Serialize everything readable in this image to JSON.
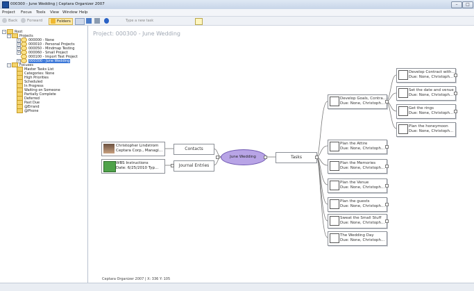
{
  "window": {
    "title": "000300 - June Wedding | Ceptara Organizer 2007"
  },
  "menu": [
    "Project",
    "Focus",
    "Tools",
    "View",
    "Window",
    "Help"
  ],
  "toolbar": {
    "back": "Back",
    "forward": "Forward",
    "folders": "Folders",
    "task_placeholder": "Type a new task"
  },
  "tree": {
    "root": "Root",
    "projects_label": "Projects",
    "projects": [
      "000000 - None",
      "000010 - Personal Projects",
      "000050 - Mindmap Testing",
      "000060 - Small Project",
      "000100 - Import Test Project",
      "000300 - June Wedding"
    ],
    "focuses_label": "Focuses",
    "focuses": [
      "Master Tasks List",
      "Categories: None",
      "High Priorities",
      "Scheduled",
      "In Progress",
      "Waiting on Someone",
      "Partially Complete",
      "Deferred",
      "Past Due",
      "@Errand",
      "@Phone"
    ]
  },
  "canvas": {
    "page_title": "Project: 000300 - June Wedding"
  },
  "mindmap": {
    "center": "June Wedding",
    "tasks_label": "Tasks",
    "contacts_label": "Contacts",
    "journal_label": "Journal Entries",
    "contact": {
      "line1": "Christopher Lindstrom",
      "line2": "Ceptara Corp., Managi..."
    },
    "journal": {
      "line1": "WBS Instructions",
      "line2": "Date: 6/25/2010 Typ..."
    },
    "tasks": [
      {
        "line1": "Develop Goals, Contra...",
        "line2": "Due: None, Christoph..."
      },
      {
        "line1": "Plan the Attire",
        "line2": "Due: None, Christoph..."
      },
      {
        "line1": "Plan the Memories",
        "line2": "Due: None, Christoph..."
      },
      {
        "line1": "Plan the Venue",
        "line2": "Due: None, Christoph..."
      },
      {
        "line1": "Plan the guests",
        "line2": "Due: None, Christoph..."
      },
      {
        "line1": "Sweat the Small Stuff",
        "line2": "Due: None, Christoph..."
      },
      {
        "line1": "The Wedding Day",
        "line2": "Due: None, Christoph..."
      }
    ],
    "subtasks": [
      {
        "line1": "Develop Contract with...",
        "line2": "Due: None, Christoph..."
      },
      {
        "line1": "Set the date and venue",
        "line2": "Due: None, Christoph..."
      },
      {
        "line1": "Get the rings",
        "line2": "Due: None, Christoph..."
      },
      {
        "line1": "Plan the honeymoon",
        "line2": "Due: None, Christoph..."
      }
    ]
  },
  "status": {
    "text": "Ceptara Organizer 2007 | X: 336 Y: 105"
  }
}
